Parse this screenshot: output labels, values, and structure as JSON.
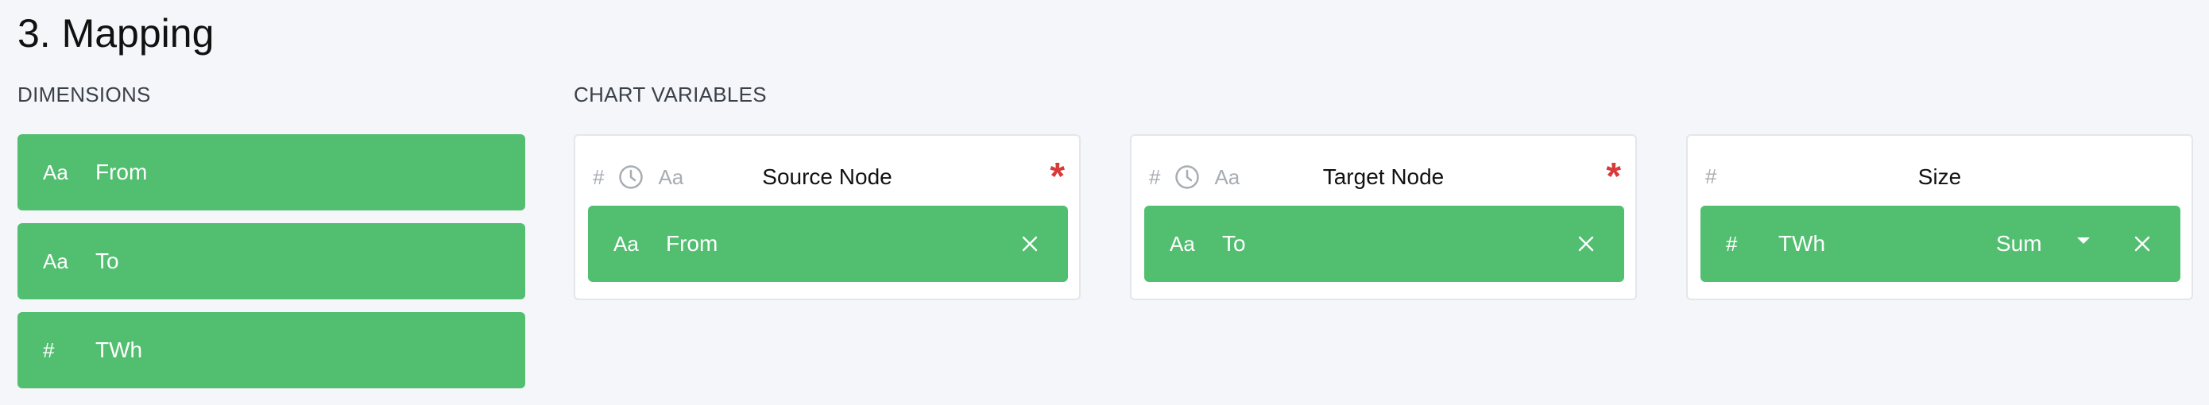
{
  "section": {
    "title": "3. Mapping"
  },
  "dimensions": {
    "label": "DIMENSIONS",
    "items": [
      {
        "type_icon": "Aa",
        "label": "From"
      },
      {
        "type_icon": "Aa",
        "label": "To"
      },
      {
        "type_icon": "#",
        "label": "TWh"
      }
    ]
  },
  "chart_variables": {
    "label": "CHART VARIABLES",
    "cards": [
      {
        "title": "Source Node",
        "accepted_types": [
          "#",
          "clock-icon",
          "Aa"
        ],
        "required": true,
        "required_mark": "*",
        "mapped": {
          "type_icon": "Aa",
          "label": "From"
        }
      },
      {
        "title": "Target Node",
        "accepted_types": [
          "#",
          "clock-icon",
          "Aa"
        ],
        "required": true,
        "required_mark": "*",
        "mapped": {
          "type_icon": "Aa",
          "label": "To"
        }
      },
      {
        "title": "Size",
        "accepted_types": [
          "#"
        ],
        "required": false,
        "mapped": {
          "type_icon": "#",
          "label": "TWh",
          "aggregation": "Sum"
        }
      }
    ]
  },
  "colors": {
    "chip": "#52bf70",
    "required": "#d63a3a",
    "background": "#f4f6f9"
  }
}
